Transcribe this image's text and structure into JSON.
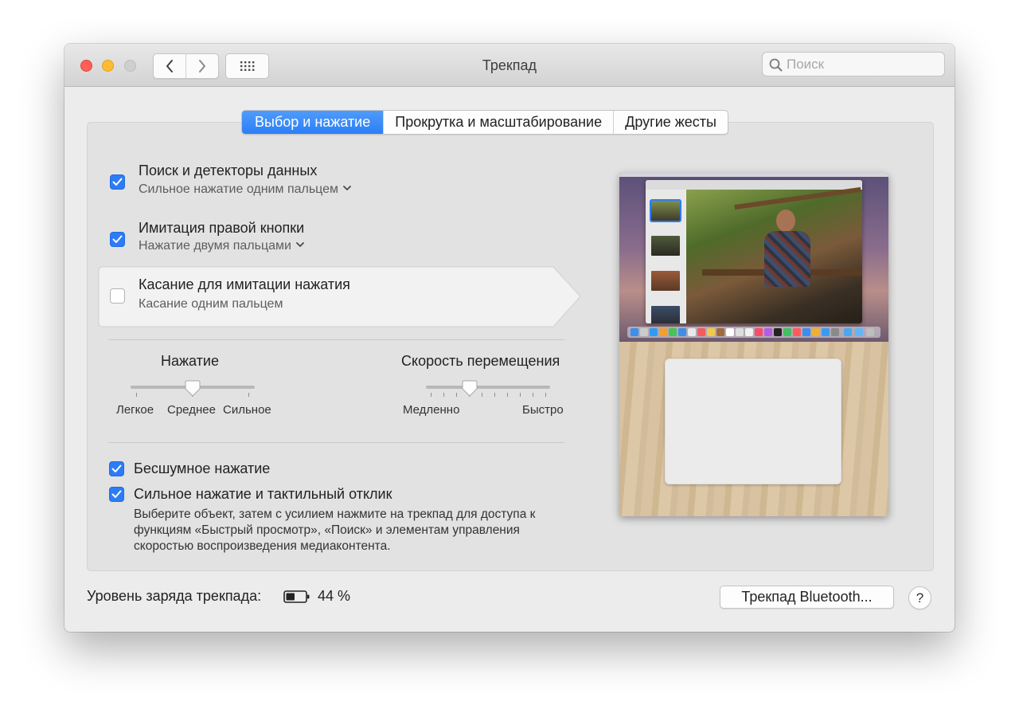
{
  "window": {
    "title": "Трекпад",
    "search_placeholder": "Поиск"
  },
  "tabs": [
    {
      "label": "Выбор и нажатие",
      "active": true
    },
    {
      "label": "Прокрутка и масштабирование",
      "active": false
    },
    {
      "label": "Другие жесты",
      "active": false
    }
  ],
  "options": [
    {
      "title": "Поиск и детекторы данных",
      "subtitle": "Сильное нажатие одним пальцем",
      "checked": true,
      "has_menu": true
    },
    {
      "title": "Имитация правой кнопки",
      "subtitle": "Нажатие двумя пальцами",
      "checked": true,
      "has_menu": true
    },
    {
      "title": "Касание для имитации нажатия",
      "subtitle": "Касание одним пальцем",
      "checked": false,
      "has_menu": false,
      "highlighted": true
    }
  ],
  "click_slider": {
    "label": "Нажатие",
    "ticks": [
      "Легкое",
      "Среднее",
      "Сильное"
    ],
    "value_index": 1
  },
  "speed_slider": {
    "label": "Скорость перемещения",
    "min_label": "Медленно",
    "max_label": "Быстро",
    "value_tick": 3,
    "tick_count": 10
  },
  "bottom_options": [
    {
      "title": "Бесшумное нажатие",
      "checked": true
    },
    {
      "title": "Сильное нажатие и тактильный отклик",
      "checked": true,
      "description": "Выберите объект, затем с усилием нажмите на трекпад для доступа к функциям «Быстрый просмотр», «Поиск» и элементам управления скоростью воспроизведения медиаконтента."
    }
  ],
  "footer": {
    "battery_label": "Уровень заряда трекпада:",
    "battery_percent": "44 %",
    "bluetooth_button": "Трекпад Bluetooth...",
    "help_label": "?"
  },
  "colors": {
    "accent": "#2d7cf6",
    "close": "#ff5f57",
    "minimize": "#febc2e"
  },
  "icons": [
    "back-chevron-icon",
    "forward-chevron-icon",
    "grid-icon",
    "search-icon",
    "checkmark-icon",
    "chevron-down-icon",
    "battery-icon"
  ]
}
